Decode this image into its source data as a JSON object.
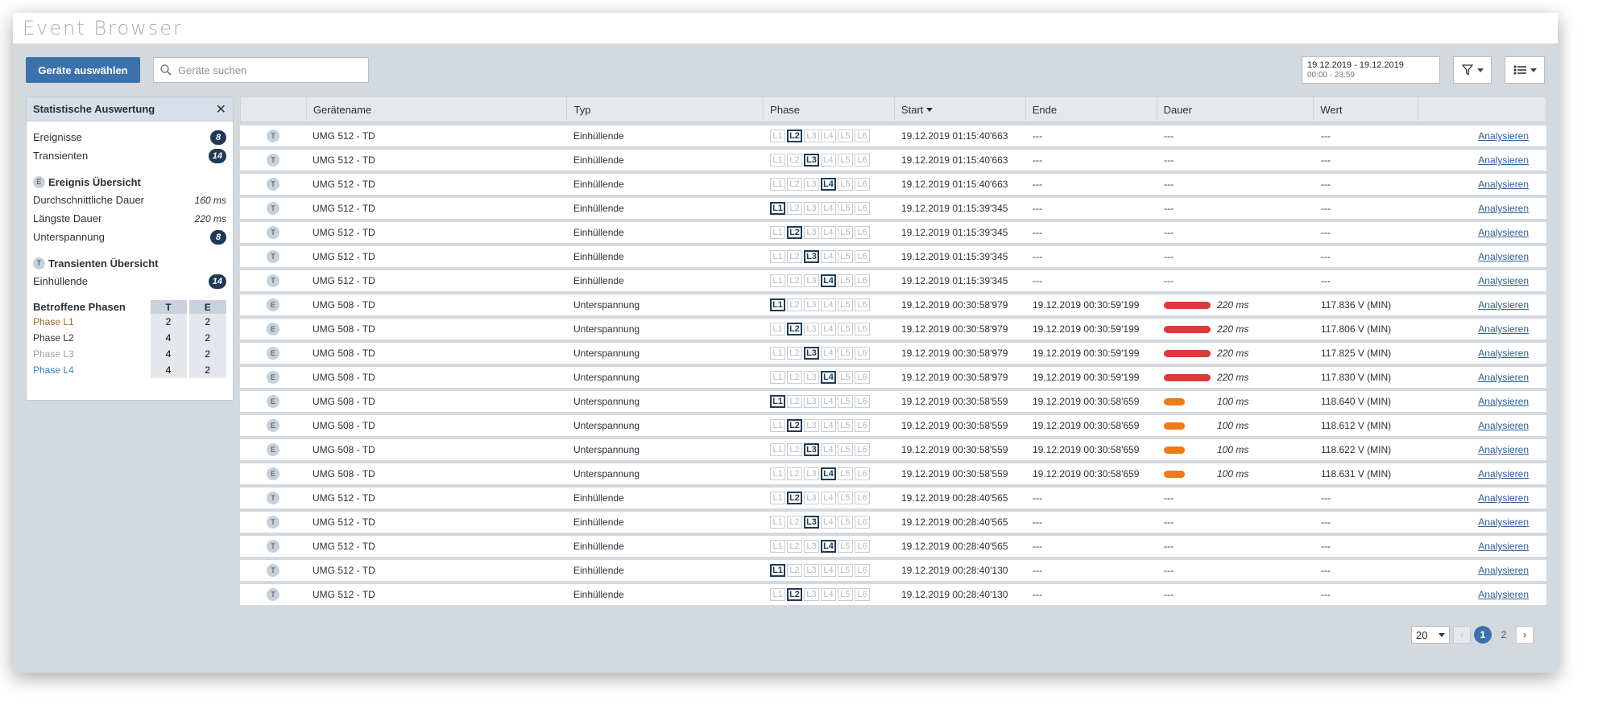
{
  "app": {
    "title": "Event Browser"
  },
  "toolbar": {
    "select_devices_label": "Geräte auswählen",
    "search_placeholder": "Geräte suchen",
    "date_range": "19.12.2019 - 19.12.2019",
    "time_range": "00:00 - 23:59",
    "filter_icon": "filter-icon",
    "list_icon": "list-icon"
  },
  "stats": {
    "title": "Statistische Auswertung",
    "events_label": "Ereignisse",
    "events_count": "8",
    "transients_label": "Transienten",
    "transients_count": "14",
    "event_overview": {
      "letter": "E",
      "title": "Ereignis Übersicht",
      "avg_label": "Durchschnittliche Dauer",
      "avg_value": "160 ms",
      "max_label": "Längste Dauer",
      "max_value": "220 ms",
      "under_label": "Unterspannung",
      "under_count": "8"
    },
    "transient_overview": {
      "letter": "T",
      "title": "Transienten Übersicht",
      "env_label": "Einhüllende",
      "env_count": "14"
    },
    "phases": {
      "title": "Betroffene Phasen",
      "col_t": "T",
      "col_e": "E",
      "rows": [
        {
          "label": "Phase L1",
          "t": "2",
          "e": "2",
          "color": "#a0662a"
        },
        {
          "label": "Phase L2",
          "t": "4",
          "e": "2",
          "color": "#2b3035"
        },
        {
          "label": "Phase L3",
          "t": "4",
          "e": "2",
          "color": "#9aa0a6"
        },
        {
          "label": "Phase L4",
          "t": "4",
          "e": "2",
          "color": "#2f7fd0"
        }
      ]
    }
  },
  "table": {
    "columns": [
      "",
      "Gerätename",
      "Typ",
      "Phase",
      "Start",
      "Ende",
      "Dauer",
      "Wert",
      ""
    ],
    "phase_labels": [
      "L1",
      "L2",
      "L3",
      "L4",
      "L5",
      "L6"
    ],
    "action_label": "Analysieren",
    "rows": [
      {
        "tag": "T",
        "device": "UMG 512 - TD",
        "type": "Einhüllende",
        "phase": 2,
        "start": "19.12.2019 01:15:40'663",
        "end": "---",
        "dur": "---",
        "dur_ms": null,
        "value": "---"
      },
      {
        "tag": "T",
        "device": "UMG 512 - TD",
        "type": "Einhüllende",
        "phase": 3,
        "start": "19.12.2019 01:15:40'663",
        "end": "---",
        "dur": "---",
        "dur_ms": null,
        "value": "---"
      },
      {
        "tag": "T",
        "device": "UMG 512 - TD",
        "type": "Einhüllende",
        "phase": 4,
        "start": "19.12.2019 01:15:40'663",
        "end": "---",
        "dur": "---",
        "dur_ms": null,
        "value": "---"
      },
      {
        "tag": "T",
        "device": "UMG 512 - TD",
        "type": "Einhüllende",
        "phase": 1,
        "start": "19.12.2019 01:15:39'345",
        "end": "---",
        "dur": "---",
        "dur_ms": null,
        "value": "---"
      },
      {
        "tag": "T",
        "device": "UMG 512 - TD",
        "type": "Einhüllende",
        "phase": 2,
        "start": "19.12.2019 01:15:39'345",
        "end": "---",
        "dur": "---",
        "dur_ms": null,
        "value": "---"
      },
      {
        "tag": "T",
        "device": "UMG 512 - TD",
        "type": "Einhüllende",
        "phase": 3,
        "start": "19.12.2019 01:15:39'345",
        "end": "---",
        "dur": "---",
        "dur_ms": null,
        "value": "---"
      },
      {
        "tag": "T",
        "device": "UMG 512 - TD",
        "type": "Einhüllende",
        "phase": 4,
        "start": "19.12.2019 01:15:39'345",
        "end": "---",
        "dur": "---",
        "dur_ms": null,
        "value": "---"
      },
      {
        "tag": "E",
        "device": "UMG 508 - TD",
        "type": "Unterspannung",
        "phase": 1,
        "start": "19.12.2019 00:30:58'979",
        "end": "19.12.2019 00:30:59'199",
        "dur": "220 ms",
        "dur_ms": 220,
        "value": "117.836 V (MIN)"
      },
      {
        "tag": "E",
        "device": "UMG 508 - TD",
        "type": "Unterspannung",
        "phase": 2,
        "start": "19.12.2019 00:30:58'979",
        "end": "19.12.2019 00:30:59'199",
        "dur": "220 ms",
        "dur_ms": 220,
        "value": "117.806 V (MIN)"
      },
      {
        "tag": "E",
        "device": "UMG 508 - TD",
        "type": "Unterspannung",
        "phase": 3,
        "start": "19.12.2019 00:30:58'979",
        "end": "19.12.2019 00:30:59'199",
        "dur": "220 ms",
        "dur_ms": 220,
        "value": "117.825 V (MIN)"
      },
      {
        "tag": "E",
        "device": "UMG 508 - TD",
        "type": "Unterspannung",
        "phase": 4,
        "start": "19.12.2019 00:30:58'979",
        "end": "19.12.2019 00:30:59'199",
        "dur": "220 ms",
        "dur_ms": 220,
        "value": "117.830 V (MIN)"
      },
      {
        "tag": "E",
        "device": "UMG 508 - TD",
        "type": "Unterspannung",
        "phase": 1,
        "start": "19.12.2019 00:30:58'559",
        "end": "19.12.2019 00:30:58'659",
        "dur": "100 ms",
        "dur_ms": 100,
        "value": "118.640 V (MIN)"
      },
      {
        "tag": "E",
        "device": "UMG 508 - TD",
        "type": "Unterspannung",
        "phase": 2,
        "start": "19.12.2019 00:30:58'559",
        "end": "19.12.2019 00:30:58'659",
        "dur": "100 ms",
        "dur_ms": 100,
        "value": "118.612 V (MIN)"
      },
      {
        "tag": "E",
        "device": "UMG 508 - TD",
        "type": "Unterspannung",
        "phase": 3,
        "start": "19.12.2019 00:30:58'559",
        "end": "19.12.2019 00:30:58'659",
        "dur": "100 ms",
        "dur_ms": 100,
        "value": "118.622 V (MIN)"
      },
      {
        "tag": "E",
        "device": "UMG 508 - TD",
        "type": "Unterspannung",
        "phase": 4,
        "start": "19.12.2019 00:30:58'559",
        "end": "19.12.2019 00:30:58'659",
        "dur": "100 ms",
        "dur_ms": 100,
        "value": "118.631 V (MIN)"
      },
      {
        "tag": "T",
        "device": "UMG 512 - TD",
        "type": "Einhüllende",
        "phase": 2,
        "start": "19.12.2019 00:28:40'565",
        "end": "---",
        "dur": "---",
        "dur_ms": null,
        "value": "---"
      },
      {
        "tag": "T",
        "device": "UMG 512 - TD",
        "type": "Einhüllende",
        "phase": 3,
        "start": "19.12.2019 00:28:40'565",
        "end": "---",
        "dur": "---",
        "dur_ms": null,
        "value": "---"
      },
      {
        "tag": "T",
        "device": "UMG 512 - TD",
        "type": "Einhüllende",
        "phase": 4,
        "start": "19.12.2019 00:28:40'565",
        "end": "---",
        "dur": "---",
        "dur_ms": null,
        "value": "---"
      },
      {
        "tag": "T",
        "device": "UMG 512 - TD",
        "type": "Einhüllende",
        "phase": 1,
        "start": "19.12.2019 00:28:40'130",
        "end": "---",
        "dur": "---",
        "dur_ms": null,
        "value": "---"
      },
      {
        "tag": "T",
        "device": "UMG 512 - TD",
        "type": "Einhüllende",
        "phase": 2,
        "start": "19.12.2019 00:28:40'130",
        "end": "---",
        "dur": "---",
        "dur_ms": null,
        "value": "---"
      }
    ]
  },
  "colors": {
    "long_duration": "#d93a3a",
    "short_duration": "#ee7a18"
  },
  "pager": {
    "page_size": "20",
    "pages": [
      "1",
      "2"
    ],
    "current": "1",
    "prev": "‹",
    "next": "›"
  }
}
